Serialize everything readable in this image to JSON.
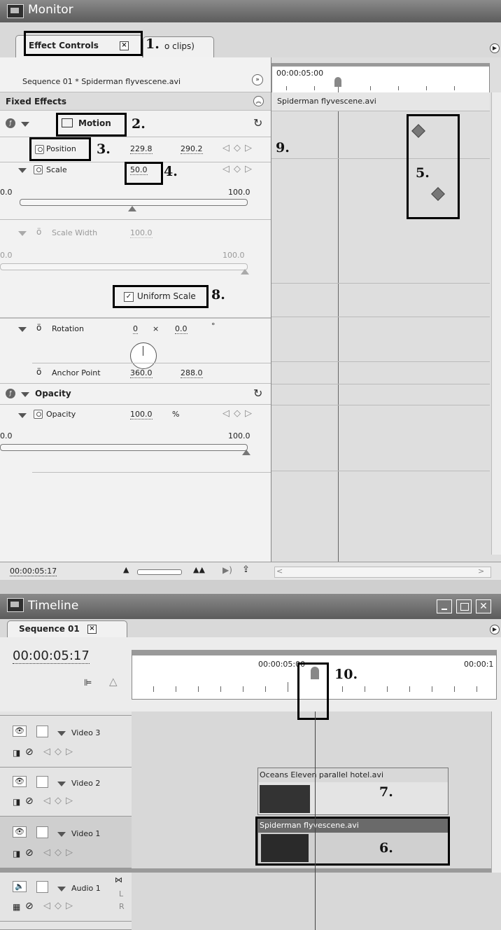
{
  "monitor": {
    "title": "Monitor",
    "tab_label": "Effect Controls",
    "tab_secondary": "o clips)",
    "sequence_label": "Sequence 01 * Spiderman flyvescene.avi",
    "mini_timecode": "00:00:05:00",
    "clip_name": "Spiderman flyvescene.avi",
    "fixed_effects_label": "Fixed Effects",
    "motion_label": "Motion",
    "position": {
      "label": "Position",
      "x": "229.8",
      "y": "290.2"
    },
    "scale": {
      "label": "Scale",
      "value": "50.0",
      "min": "0.0",
      "max": "100.0"
    },
    "scale_width": {
      "label": "Scale Width",
      "value": "100.0",
      "min": "0.0",
      "max": "100.0"
    },
    "uniform_scale": {
      "label": "Uniform Scale",
      "checked": true
    },
    "rotation": {
      "label": "Rotation",
      "turns": "0",
      "times": "×",
      "degrees": "0.0",
      "deg_symbol": "°"
    },
    "anchor_point": {
      "label": "Anchor Point",
      "x": "360.0",
      "y": "288.0"
    },
    "opacity_section_label": "Opacity",
    "opacity": {
      "label": "Opacity",
      "value": "100.0",
      "unit": "%",
      "min": "0.0",
      "max": "100.0"
    },
    "footer_timecode": "00:00:05:17"
  },
  "timeline": {
    "title": "Timeline",
    "tab_label": "Sequence 01",
    "current_timecode": "00:00:05:17",
    "ruler_label_1": "00:00:05:00",
    "ruler_label_2": "00:00:1",
    "tracks": [
      {
        "name": "Video 3"
      },
      {
        "name": "Video 2"
      },
      {
        "name": "Video 1"
      },
      {
        "name": "Audio 1",
        "ch_left": "L",
        "ch_right": "R"
      }
    ],
    "clip_oceans": "Oceans Eleven parallel hotel.avi",
    "clip_spiderman": "Spiderman flyvescene.avi"
  },
  "callouts": {
    "c1": "1.",
    "c2": "2.",
    "c3": "3.",
    "c4": "4.",
    "c5": "5.",
    "c6": "6.",
    "c7": "7.",
    "c8": "8.",
    "c9": "9.",
    "c10": "10."
  }
}
